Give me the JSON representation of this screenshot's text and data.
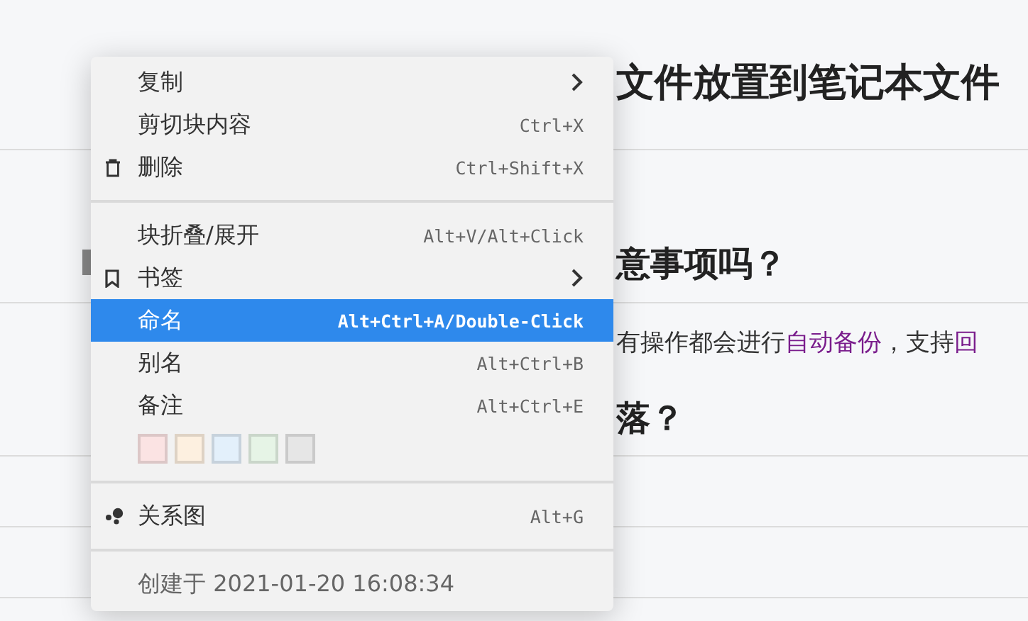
{
  "document": {
    "blocks": [
      {
        "kind": "heading",
        "text": "文件放置到笔记本文件"
      },
      {
        "kind": "heading-handle",
        "text": "意事项吗？"
      },
      {
        "kind": "paragraph",
        "text": "有操作都会进行",
        "link": "自动备份",
        "rest": "，支持",
        "link2": "回"
      },
      {
        "kind": "heading-last",
        "text": "落？"
      },
      {
        "kind": "empty"
      },
      {
        "kind": "empty"
      }
    ]
  },
  "menu": {
    "items": [
      {
        "kind": "item",
        "label": "复制",
        "submenu": true,
        "selected": false
      },
      {
        "kind": "item",
        "label": "剪切块内容",
        "shortcut": "Ctrl+X",
        "submenu": false,
        "selected": false
      },
      {
        "kind": "delete",
        "label": "删除",
        "shortcut": "Ctrl+Shift+X",
        "submenu": false,
        "selected": false
      },
      {
        "kind": "separator"
      },
      {
        "kind": "item",
        "label": "块折叠/展开",
        "shortcut": "Alt+V/Alt+Click",
        "submenu": false,
        "selected": false
      },
      {
        "kind": "bookmark",
        "label": "书签",
        "submenu": true,
        "selected": false
      },
      {
        "kind": "item",
        "label": "命名",
        "shortcut": "Alt+Ctrl+A/Double-Click",
        "submenu": false,
        "selected": true
      },
      {
        "kind": "item",
        "label": "别名",
        "shortcut": "Alt+Ctrl+B",
        "submenu": false,
        "selected": false
      },
      {
        "kind": "item",
        "label": "备注",
        "shortcut": "Alt+Ctrl+E",
        "submenu": false,
        "selected": false
      },
      {
        "kind": "swatches",
        "swatches": [
          {
            "color": "#fbe3e3"
          },
          {
            "color": "#fdf0e0"
          },
          {
            "color": "#e3f0fb"
          },
          {
            "color": "#e6f4e6"
          },
          {
            "color": "#e6e6e6"
          }
        ]
      },
      {
        "kind": "separator"
      },
      {
        "kind": "graph",
        "label": "关系图",
        "shortcut": "Alt+G",
        "submenu": false,
        "selected": false
      },
      {
        "kind": "separator"
      },
      {
        "kind": "footer",
        "text": "创建于 2021-01-20 16:08:34"
      }
    ]
  }
}
